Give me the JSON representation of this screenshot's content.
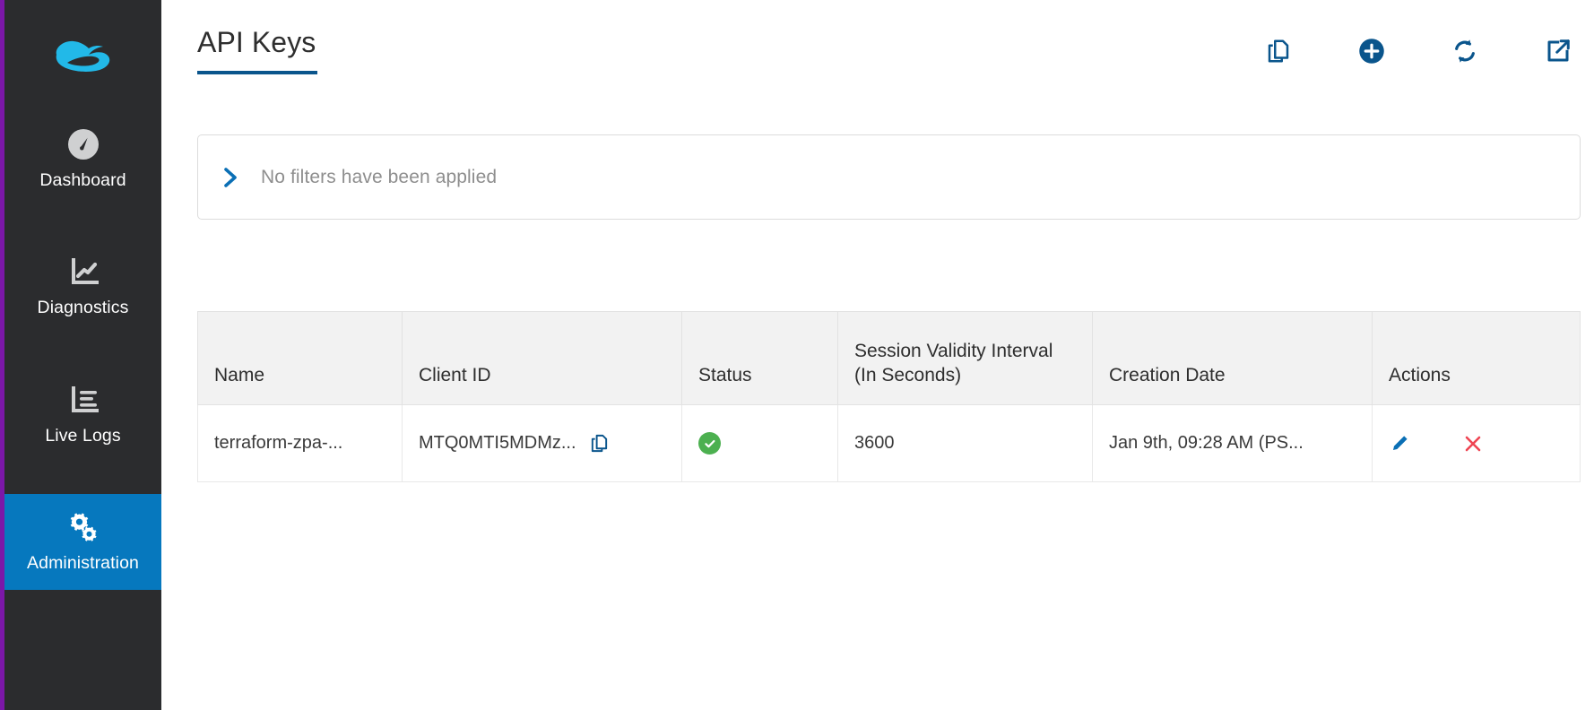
{
  "brand": {
    "logo_name": "zscaler-cloud-logo",
    "accent_blue": "#0678be",
    "dark_bg": "#2b2c2e",
    "edge_purple": "#7b17a8",
    "icon_blue": "#0a558c",
    "status_green": "#4cb050",
    "delete_red": "#ef4452"
  },
  "sidebar": {
    "items": [
      {
        "label": "Dashboard",
        "icon": "gauge-icon",
        "active": false
      },
      {
        "label": "Diagnostics",
        "icon": "line-chart-icon",
        "active": false
      },
      {
        "label": "Live Logs",
        "icon": "bar-log-icon",
        "active": false
      },
      {
        "label": "Administration",
        "icon": "gears-icon",
        "active": true
      }
    ]
  },
  "header": {
    "title": "API Keys",
    "actions": [
      {
        "name": "copy-button",
        "icon": "copy-icon",
        "tooltip": "Copy"
      },
      {
        "name": "add-button",
        "icon": "plus-circle-icon",
        "tooltip": "Add"
      },
      {
        "name": "refresh-button",
        "icon": "refresh-icon",
        "tooltip": "Refresh"
      },
      {
        "name": "export-button",
        "icon": "external-link-icon",
        "tooltip": "Export"
      }
    ]
  },
  "filter": {
    "chevron_icon": "chevron-right-icon",
    "text": "No filters have been applied"
  },
  "table": {
    "columns": [
      "Name",
      "Client ID",
      "Status",
      "Session Validity Interval (In Seconds)",
      "Creation Date",
      "Actions"
    ],
    "rows": [
      {
        "name": "terraform-zpa-...",
        "client_id": "MTQ0MTI5MDMz...",
        "client_id_copy_icon": "copy-icon",
        "status": "enabled",
        "status_icon": "check-circle-icon",
        "session_validity": "3600",
        "creation_date": "Jan 9th, 09:28 AM (PS...",
        "actions": [
          {
            "name": "edit-row-button",
            "icon": "pencil-icon"
          },
          {
            "name": "delete-row-button",
            "icon": "close-x-icon"
          }
        ]
      }
    ]
  }
}
